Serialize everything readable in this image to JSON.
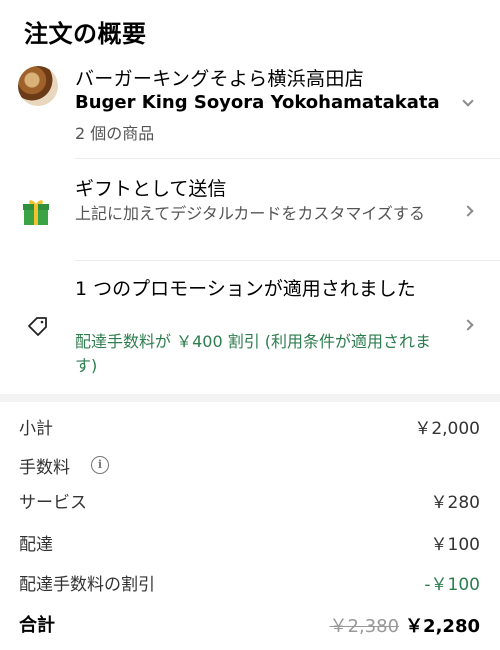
{
  "header": {
    "title": "注文の概要"
  },
  "store": {
    "name_jp": "バーガーキングそよら横浜高田店",
    "name_en": "Buger King Soyora Yokohamatakata",
    "items": "2 個の商品"
  },
  "gift": {
    "title": "ギフトとして送信",
    "subtitle": "上記に加えてデジタルカードをカスタマイズする"
  },
  "promo": {
    "title": "1 つのプロモーションが適用されました",
    "subtitle": "配達手数料が ￥400 割引 (利用条件が適用されます)"
  },
  "summary": {
    "subtotal_label": "小計",
    "subtotal_value": "￥2,000",
    "fees_label": "手数料",
    "service_label": "サービス",
    "service_value": "￥280",
    "delivery_label": "配達",
    "delivery_value": "￥100",
    "discount_label": "配達手数料の割引",
    "discount_value": "-￥100",
    "total_label": "合計",
    "total_original": "￥2,380",
    "total_value": "￥2,280"
  },
  "icons": {
    "store": "store-thumbnail",
    "gift": "gift-icon",
    "promo": "tag-icon",
    "info": "info-icon",
    "expand": "chevron-down-icon",
    "navigate": "chevron-right-icon"
  },
  "colors": {
    "accent_green": "#2e7d4f",
    "gift_green": "#3aa345",
    "gift_ribbon": "#f2c230"
  }
}
